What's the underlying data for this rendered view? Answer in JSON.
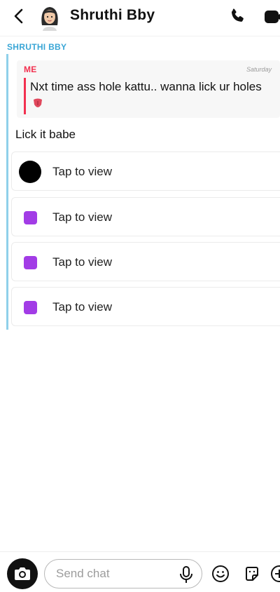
{
  "header": {
    "contact_name": "Shruthi Bby"
  },
  "conversation": {
    "sender_label": "SHRUTHI BBY",
    "reply": {
      "author": "ME",
      "time": "Saturday",
      "text": "Nxt time ass hole kattu.. wanna lick ur holes",
      "emoji": "tongue-emoji"
    },
    "message": "Lick it babe",
    "snaps": [
      {
        "label": "Tap to view",
        "icon": "circle",
        "color": "#000000"
      },
      {
        "label": "Tap to view",
        "icon": "square",
        "color": "#a23ce6"
      },
      {
        "label": "Tap to view",
        "icon": "square",
        "color": "#a23ce6"
      },
      {
        "label": "Tap to view",
        "icon": "square",
        "color": "#a23ce6"
      }
    ]
  },
  "composer": {
    "placeholder": "Send chat"
  },
  "colors": {
    "sender_blue": "#3aa6d6",
    "me_red": "#f2304f",
    "snap_purple": "#a23ce6"
  }
}
